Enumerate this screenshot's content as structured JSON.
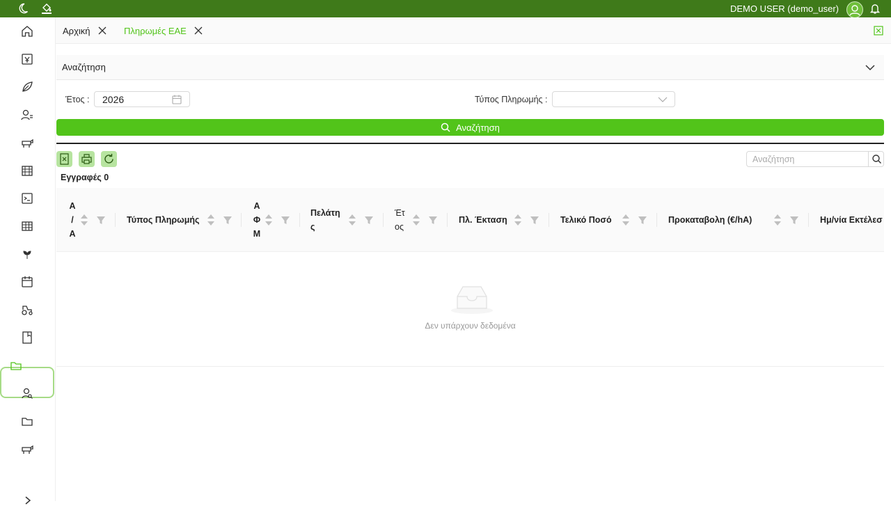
{
  "topbar": {
    "user": "DEMO USER (demo_user)",
    "icons": [
      "moon-icon",
      "paint-bucket-icon",
      "user-avatar-icon",
      "bell-icon"
    ]
  },
  "sidebar": {
    "items": [
      "home-icon",
      "receipt-yen-icon",
      "leaf-icon",
      "user-list-icon",
      "sheep-icon",
      "warehouse-icon",
      "terminal-icon",
      "table-icon",
      "plant-icon",
      "calendar-icon",
      "tractor-icon",
      "book-icon",
      "folder-icon",
      "user-search-icon",
      "folder-icon",
      "sheep-icon"
    ],
    "active": "folder-icon"
  },
  "tabs": [
    {
      "label": "Αρχική",
      "active": false
    },
    {
      "label": "Πληρωμές ΕΑΕ",
      "active": true
    }
  ],
  "search": {
    "panel_title": "Αναζήτηση",
    "year_label": "Έτος :",
    "year_value": "2026",
    "payment_type_label": "Τύπος Πληρωμής :",
    "payment_type_value": "",
    "button_label": "Αναζήτηση"
  },
  "table": {
    "search_placeholder": "Αναζήτηση",
    "records_label": "Εγγραφές 0",
    "columns": [
      {
        "label": "Α / Α"
      },
      {
        "label": "Τύπος Πληρωμής"
      },
      {
        "label": "Α Φ Μ"
      },
      {
        "label": "Πελάτης"
      },
      {
        "label": "Έτος"
      },
      {
        "label": "Πλ. Έκταση"
      },
      {
        "label": "Τελικό Ποσό"
      },
      {
        "label": "Προκαταβολη (€/hA)"
      },
      {
        "label": "Ημ/νία Εκτέλεσ"
      }
    ],
    "empty_text": "Δεν υπάρχουν δεδομένα"
  },
  "colors": {
    "topbar": "#3f7a1a",
    "accent": "#52c41a",
    "active_tab": "#52c41a"
  }
}
